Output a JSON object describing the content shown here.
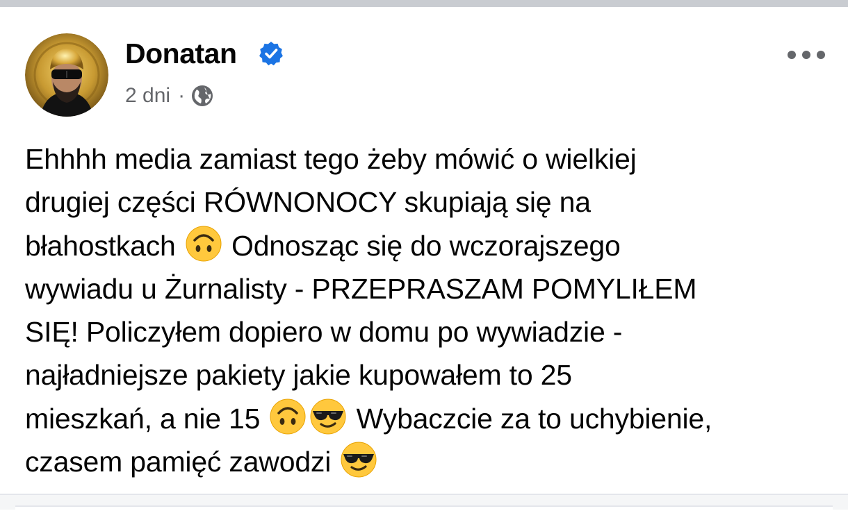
{
  "post": {
    "author": "Donatan",
    "verified_icon": "verified-badge-icon",
    "time": "2 dni",
    "separator": "·",
    "audience_icon": "globe-icon",
    "more_icon": "more-options-icon",
    "text_lines": [
      [
        "Ehhhh media zamiast tego żeby mówić o wielkiej"
      ],
      [
        "drugiej części RÓWNONOCY skupiają się na"
      ],
      [
        "błahostkach ",
        "upside-down-face-emoji",
        " Odnosząc się do wczorajszego"
      ],
      [
        "wywiadu u Żurnalisty - PRZEPRASZAM POMYLIŁEM"
      ],
      [
        "SIĘ! Policzyłem dopiero w domu po wywiadzie -"
      ],
      [
        "najładniejsze pakiety jakie kupowałem to 25"
      ],
      [
        "mieszkań, a nie 15 ",
        "upside-down-face-emoji",
        "smiling-face-with-sunglasses-emoji",
        " Wybaczcie za to uchybienie,"
      ],
      [
        "czasem pamięć zawodzi ",
        "smiling-face-with-sunglasses-emoji"
      ]
    ]
  },
  "colors": {
    "verified_blue": "#1b74e4",
    "secondary_text": "#65676b",
    "divider": "#c9ccd1",
    "emoji_yellow": "#ffc83d"
  }
}
